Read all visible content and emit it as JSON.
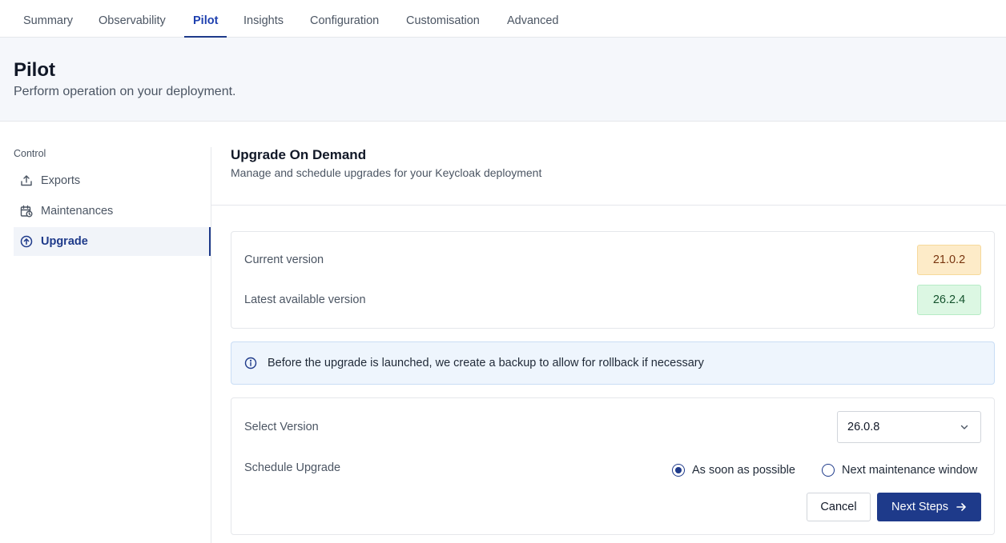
{
  "tabs": [
    "Summary",
    "Observability",
    "Pilot",
    "Insights",
    "Configuration",
    "Customisation",
    "Advanced"
  ],
  "active_tab": "Pilot",
  "header": {
    "title": "Pilot",
    "subtitle": "Perform operation on your deployment."
  },
  "sidebar": {
    "heading": "Control",
    "items": [
      {
        "label": "Exports",
        "icon": "export-icon"
      },
      {
        "label": "Maintenances",
        "icon": "calendar-clock-icon"
      },
      {
        "label": "Upgrade",
        "icon": "arrow-up-circle-icon"
      }
    ],
    "active": "Upgrade"
  },
  "section": {
    "title": "Upgrade On Demand",
    "subtitle": "Manage and schedule upgrades for your Keycloak deployment"
  },
  "versions": {
    "current_label": "Current version",
    "current_value": "21.0.2",
    "latest_label": "Latest available version",
    "latest_value": "26.2.4"
  },
  "info": {
    "text": "Before the upgrade is launched, we create a backup to allow for rollback if necessary",
    "icon": "info-icon"
  },
  "form": {
    "select_label": "Select Version",
    "select_value": "26.0.8",
    "schedule_label": "Schedule Upgrade",
    "option_asap": "As soon as possible",
    "option_maintenance": "Next maintenance window",
    "selected_option": "As soon as possible",
    "cancel_label": "Cancel",
    "next_label": "Next Steps"
  },
  "colors": {
    "accent": "#1e3a8a",
    "current_badge_bg": "#fdebc8",
    "latest_badge_bg": "#dcf7e3",
    "info_bg": "#eef5fd"
  }
}
